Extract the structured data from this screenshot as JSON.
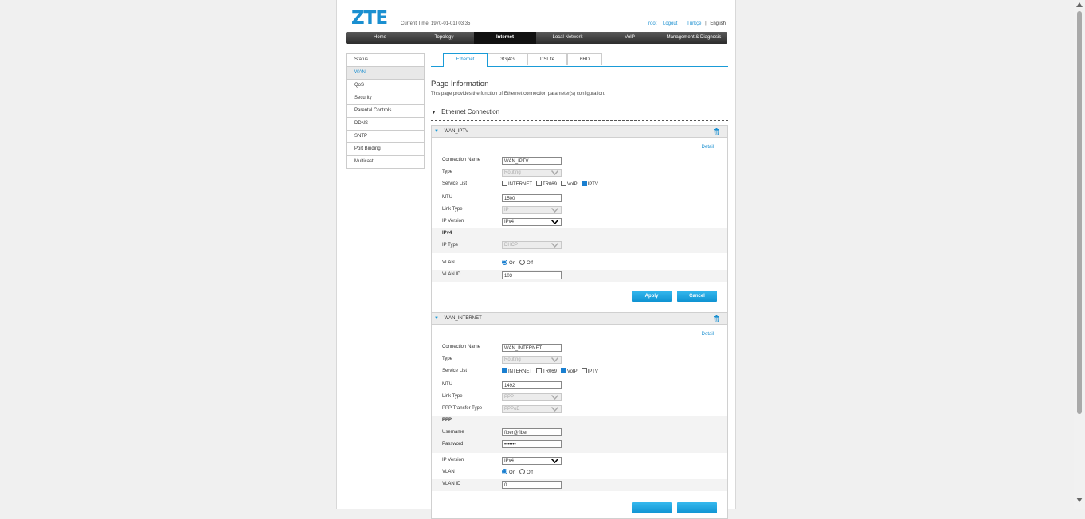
{
  "header": {
    "logo": "ZTE",
    "current_time": "Current Time: 1970-01-01T03:35",
    "user": "root",
    "logout": "Logout",
    "lang_tr": "Türkçe",
    "separator": "|",
    "lang_en": "English"
  },
  "nav": {
    "home": "Home",
    "topology": "Topology",
    "internet": "Internet",
    "local_network": "Local Network",
    "voip": "VoIP",
    "management": "Management & Diagnosis"
  },
  "sidebar": {
    "status": "Status",
    "wan": "WAN",
    "qos": "QoS",
    "security": "Security",
    "parental": "Parental Controls",
    "ddns": "DDNS",
    "sntp": "SNTP",
    "port_binding": "Port Binding",
    "multicast": "Multicast"
  },
  "tabs": {
    "ethernet": "Ethernet",
    "g34": "3G|4G",
    "dslite": "DSLite",
    "rd6": "6RD"
  },
  "page_info": {
    "title": "Page Information",
    "description": "This page provides the function of Ethernet connection parameter(s) configuration."
  },
  "section": {
    "title": "Ethernet Connection"
  },
  "labels": {
    "connection_name": "Connection Name",
    "type": "Type",
    "service_list": "Service List",
    "mtu": "MTU",
    "link_type": "Link Type",
    "ip_version": "IP Version",
    "ipv4": "IPv4",
    "ip_type": "IP Type",
    "vlan": "VLAN",
    "vlan_id": "VLAN ID",
    "ppp_transfer_type": "PPP Transfer Type",
    "ppp": "PPP",
    "username": "Username",
    "password": "Password",
    "detail": "Detail",
    "on": "On",
    "off": "Off",
    "svc_internet": "INTERNET",
    "svc_tr069": "TR069",
    "svc_voip": "VoIP",
    "svc_iptv": "IPTV",
    "apply": "Apply",
    "cancel": "Cancel"
  },
  "wan_iptv": {
    "title": "WAN_IPTV",
    "connection_name": "WAN_IPTV",
    "type": "Routing",
    "services": {
      "internet": false,
      "tr069": false,
      "voip": false,
      "iptv": true
    },
    "mtu": "1500",
    "link_type": "IP",
    "ip_version": "IPv4",
    "ip_type": "DHCP",
    "vlan": "On",
    "vlan_id": "103"
  },
  "wan_internet": {
    "title": "WAN_INTERNET",
    "connection_name": "WAN_INTERNET",
    "type": "Routing",
    "services": {
      "internet": true,
      "tr069": false,
      "voip": true,
      "iptv": false
    },
    "mtu": "1492",
    "link_type": "PPP",
    "ppp_transfer_type": "PPPoE",
    "username": "fiber@fiber",
    "password": "•••••••",
    "ip_version": "IPv4",
    "vlan": "On",
    "vlan_id": "0"
  },
  "colors": {
    "accent": "#1a8fd0",
    "button": "#1a9bd7",
    "nav_dark": "#2c2c2c"
  }
}
